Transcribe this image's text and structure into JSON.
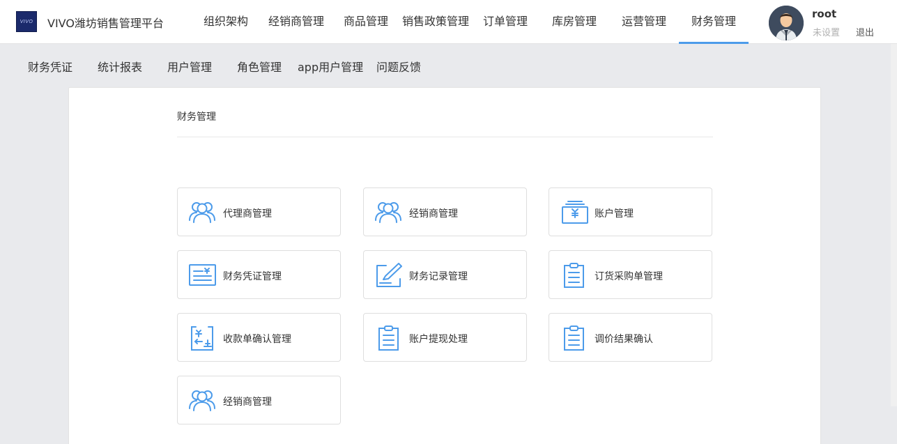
{
  "app": {
    "logo_text": "VIVO",
    "title": "VIVO潍坊销售管理平台"
  },
  "main_nav": [
    {
      "label": "组织架构",
      "active": false
    },
    {
      "label": "经销商管理",
      "active": false
    },
    {
      "label": "商品管理",
      "active": false
    },
    {
      "label": "销售政策管理",
      "active": false
    },
    {
      "label": "订单管理",
      "active": false
    },
    {
      "label": "库房管理",
      "active": false
    },
    {
      "label": "运营管理",
      "active": false
    },
    {
      "label": "财务管理",
      "active": true
    }
  ],
  "user": {
    "name": "root",
    "status": "未设置",
    "logout": "退出"
  },
  "sub_nav": [
    {
      "label": "财务凭证"
    },
    {
      "label": "统计报表"
    },
    {
      "label": "用户管理"
    },
    {
      "label": "角色管理"
    },
    {
      "label": "app用户管理"
    },
    {
      "label": "问题反馈"
    }
  ],
  "panel": {
    "title": "财务管理"
  },
  "cards": [
    {
      "label": "代理商管理",
      "icon": "users-icon"
    },
    {
      "label": "经销商管理",
      "icon": "users-icon"
    },
    {
      "label": "账户管理",
      "icon": "cash-register-icon"
    },
    {
      "label": "财务凭证管理",
      "icon": "voucher-icon"
    },
    {
      "label": "财务记录管理",
      "icon": "edit-record-icon"
    },
    {
      "label": "订货采购单管理",
      "icon": "clipboard-icon"
    },
    {
      "label": "收款单确认管理",
      "icon": "receipt-exchange-icon"
    },
    {
      "label": "账户提现处理",
      "icon": "clipboard-icon"
    },
    {
      "label": "调价结果确认",
      "icon": "clipboard-icon"
    },
    {
      "label": "经销商管理",
      "icon": "users-icon"
    }
  ],
  "colors": {
    "accent": "#4c9bea",
    "background": "#e9eaed"
  }
}
